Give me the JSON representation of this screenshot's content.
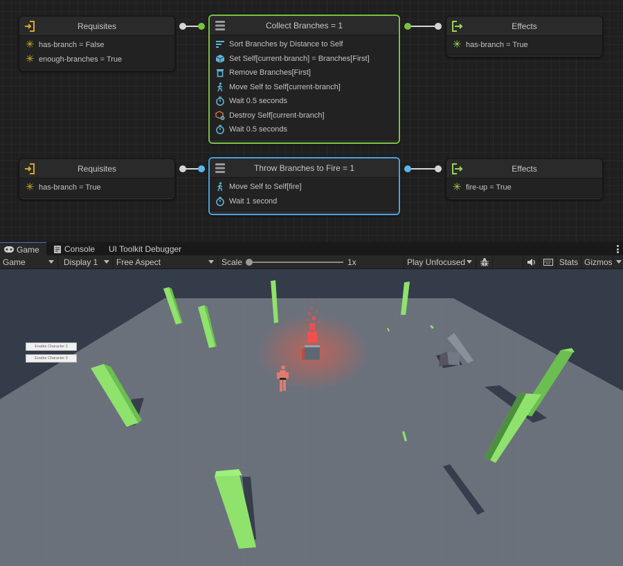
{
  "graph": {
    "rows": [
      {
        "requisites": {
          "title": "Requisites",
          "icon": "enter-icon",
          "items": [
            {
              "icon": "asterisk-icon",
              "text": "has-branch = False"
            },
            {
              "icon": "asterisk-icon",
              "text": "enough-branches = True"
            }
          ]
        },
        "action": {
          "title": "Collect Branches = 1",
          "icon": "menu-icon",
          "selection_color": "#7ac143",
          "items": [
            {
              "icon": "sort-icon",
              "text": "Sort Branches by Distance to Self"
            },
            {
              "icon": "cube-icon",
              "text": "Set Self[current-branch] = Branches[First]"
            },
            {
              "icon": "trash-icon",
              "text": "Remove Branches[First]"
            },
            {
              "icon": "walk-icon",
              "text": "Move Self to Self[current-branch]"
            },
            {
              "icon": "stopwatch-icon",
              "text": "Wait 0.5 seconds"
            },
            {
              "icon": "destroy-cube-icon",
              "text": "Destroy Self[current-branch]"
            },
            {
              "icon": "stopwatch-icon",
              "text": "Wait 0.5 seconds"
            }
          ]
        },
        "effects": {
          "title": "Effects",
          "icon": "exit-icon",
          "items": [
            {
              "icon": "asterisk-icon",
              "text": "has-branch = True"
            }
          ]
        }
      },
      {
        "requisites": {
          "title": "Requisites",
          "icon": "enter-icon",
          "items": [
            {
              "icon": "asterisk-icon",
              "text": "has-branch = True"
            }
          ]
        },
        "action": {
          "title": "Throw Branches to Fire = 1",
          "icon": "menu-icon",
          "selection_color": "#4aa3df",
          "items": [
            {
              "icon": "walk-icon",
              "text": "Move Self to Self[fire]"
            },
            {
              "icon": "stopwatch-icon",
              "text": "Wait 1 second"
            }
          ]
        },
        "effects": {
          "title": "Effects",
          "icon": "exit-icon",
          "items": [
            {
              "icon": "asterisk-icon",
              "text": "fire-up = True"
            }
          ]
        }
      }
    ],
    "colors": {
      "requisite_accent": "#d9a82b",
      "effect_accent": "#9fd05a",
      "action_icon": "#5eb6d6",
      "destroy_icon": "#d9773e"
    }
  },
  "editor": {
    "tabs": [
      {
        "label": "Game",
        "icon": "gamepad-icon",
        "active": true
      },
      {
        "label": "Console",
        "icon": "console-icon",
        "active": false
      },
      {
        "label": "UI Toolkit Debugger",
        "icon": "",
        "active": false
      }
    ],
    "toolbar": {
      "view_mode": "Game",
      "display": "Display 1",
      "aspect": "Free Aspect",
      "scale_label": "Scale",
      "scale_value": "1x",
      "scale_slider_fraction": 0.0,
      "play_mode": "Play Unfocused",
      "stats": "Stats",
      "gizmos": "Gizmos"
    }
  },
  "game_view": {
    "buttons": [
      {
        "label": "Enable Character 2"
      },
      {
        "label": "Enable Character 3"
      }
    ]
  }
}
